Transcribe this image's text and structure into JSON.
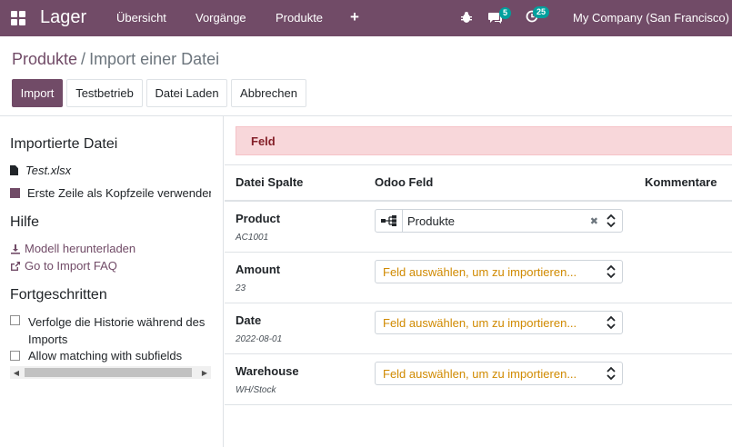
{
  "navbar": {
    "brand": "Lager",
    "menu": [
      "Übersicht",
      "Vorgänge",
      "Produkte"
    ],
    "plus": "+",
    "messages_count": "5",
    "activities_count": "25",
    "company": "My Company (San Francisco)"
  },
  "breadcrumb": {
    "parent": "Produkte",
    "separator": "/",
    "current": "Import einer Datei"
  },
  "buttons": {
    "import": "Import",
    "test": "Testbetrieb",
    "load": "Datei Laden",
    "cancel": "Abbrechen"
  },
  "sidebar": {
    "imported_title": "Importierte Datei",
    "file_name": "Test.xlsx",
    "header_row": "Erste Zeile als Kopfzeile verwenden",
    "help_title": "Hilfe",
    "download_link": "Modell herunterladen",
    "faq_link": "Go to Import FAQ",
    "advanced_title": "Fortgeschritten",
    "track_history_line1": "Verfolge die Historie während des",
    "track_history_line2": "Imports",
    "allow_matching": "Allow matching with subfields"
  },
  "alert": "Feld",
  "table": {
    "headers": [
      "Datei Spalte",
      "Odoo Feld",
      "Kommentare"
    ],
    "rows": [
      {
        "name": "Product",
        "sample": "AC1001",
        "field": "Produkte",
        "placeholder": ""
      },
      {
        "name": "Amount",
        "sample": "23",
        "field": "",
        "placeholder": "Feld auswählen, um zu importieren..."
      },
      {
        "name": "Date",
        "sample": "2022-08-01",
        "field": "",
        "placeholder": "Feld auswählen, um zu importieren..."
      },
      {
        "name": "Warehouse",
        "sample": "WH/Stock",
        "field": "",
        "placeholder": "Feld auswählen, um zu importieren..."
      }
    ]
  },
  "colors": {
    "brand": "#714b67",
    "badge": "#00a09d",
    "alert_bg": "#f8d7da",
    "placeholder": "#d08a00"
  }
}
